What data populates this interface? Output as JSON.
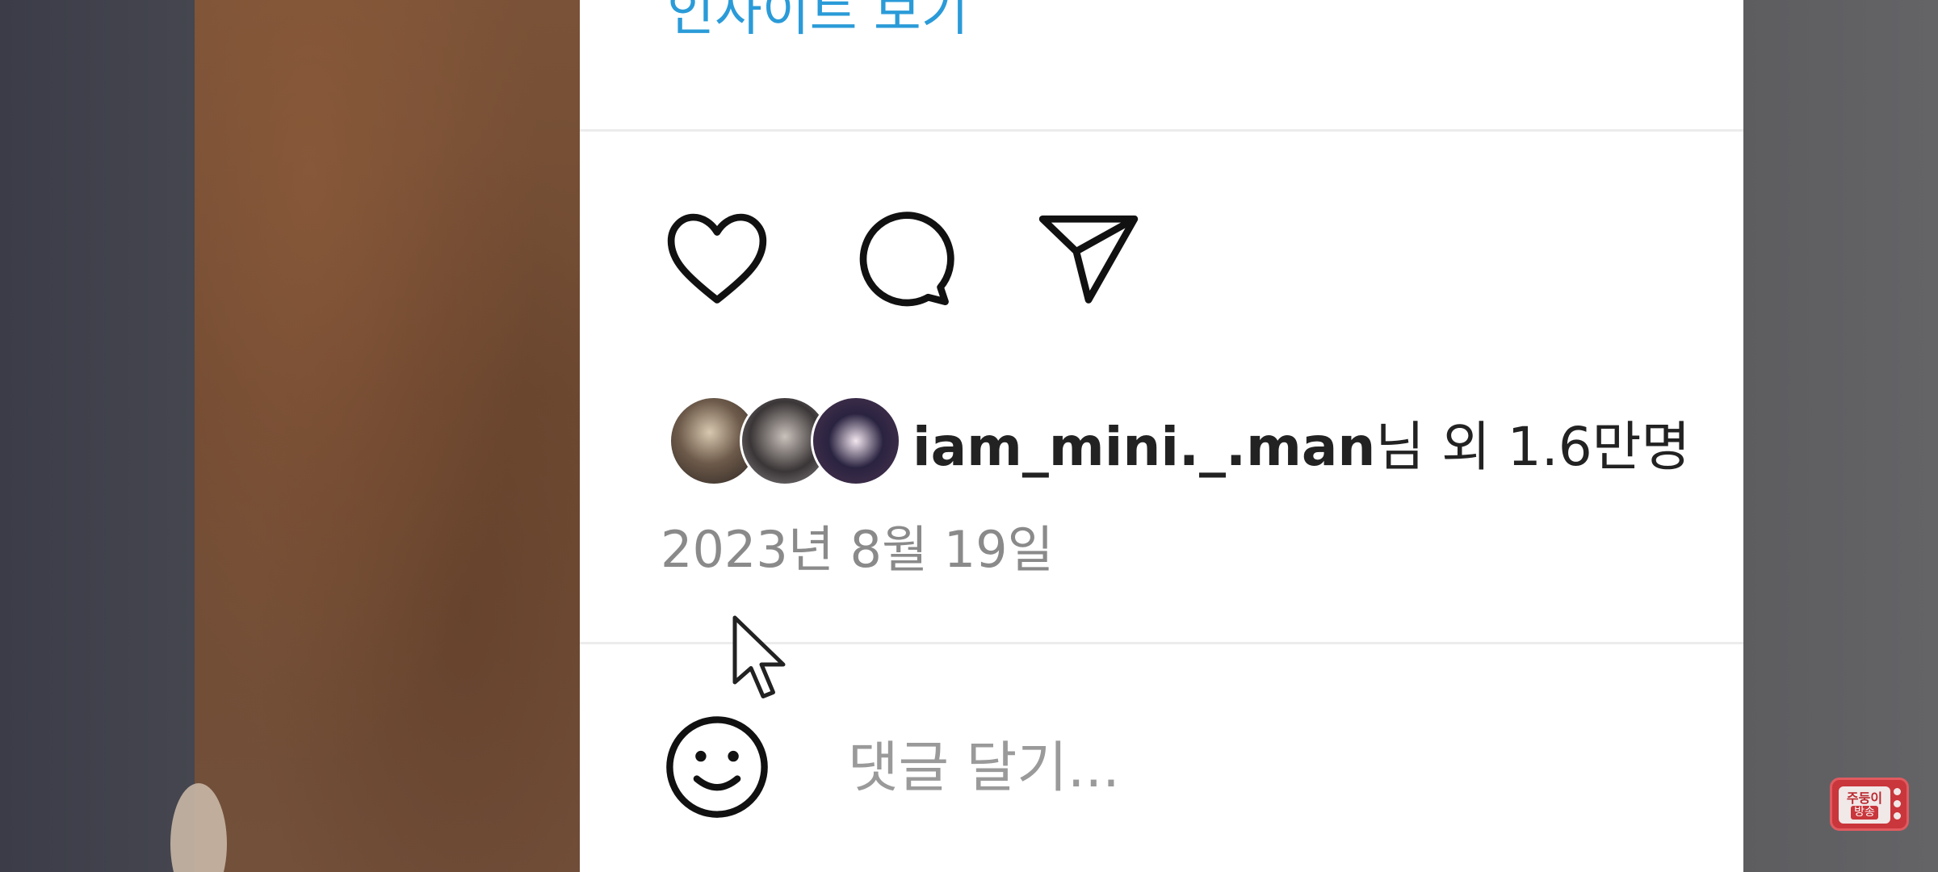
{
  "post": {
    "insights_link": "인사이트 보기",
    "likes": {
      "username": "iam_mini._.man",
      "suffix": "님 외 1.6만명"
    },
    "date": "2023년 8월 19일"
  },
  "comment_box": {
    "placeholder": "댓글 달기..."
  },
  "watermark": {
    "line1": "주둥이",
    "line2": "방송"
  },
  "colors": {
    "link": "#2a9bd8",
    "date_text": "#8a8a8a",
    "watermark": "#c9363b"
  },
  "icons": [
    "heart-icon",
    "comment-bubble-icon",
    "paper-plane-icon",
    "smiley-icon",
    "mouse-cursor-icon"
  ]
}
